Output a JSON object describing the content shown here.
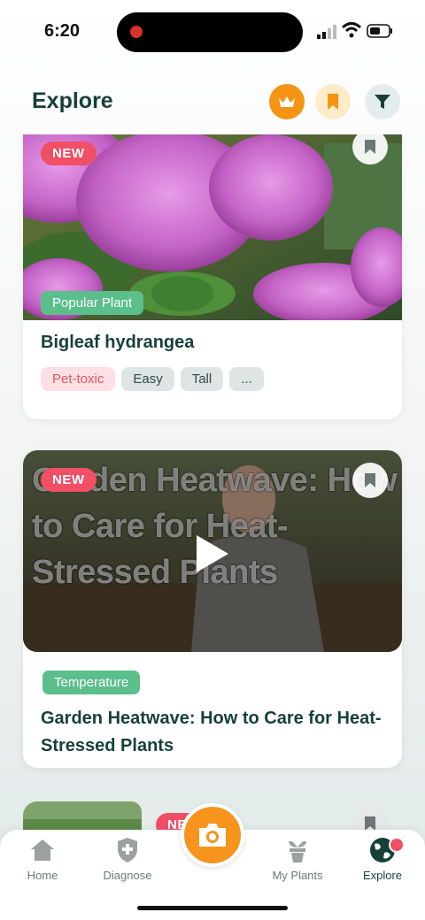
{
  "status": {
    "time": "6:20"
  },
  "header": {
    "title": "Explore",
    "icons": [
      "crown-icon",
      "bookmark-icon",
      "filter-icon"
    ]
  },
  "feed": {
    "cards": [
      {
        "badge": "NEW",
        "category": "Popular Plant",
        "title": "Bigleaf hydrangea",
        "tags": [
          "Pet-toxic",
          "Easy",
          "Tall",
          "..."
        ]
      },
      {
        "badge": "NEW",
        "video_overlay_text": "Garden Heatwave: How to Care for Heat-Stressed Plants",
        "category": "Temperature",
        "title": "Garden Heatwave: How to Care for Heat-Stressed Plants"
      },
      {
        "badge": "NEW"
      }
    ]
  },
  "tabbar": {
    "home": "Home",
    "diagnose": "Diagnose",
    "my_plants": "My Plants",
    "explore": "Explore"
  },
  "colors": {
    "accent": "#f7941d",
    "brand": "#163f3a",
    "new_badge": "#f04f66",
    "category": "#5bbf8c"
  }
}
